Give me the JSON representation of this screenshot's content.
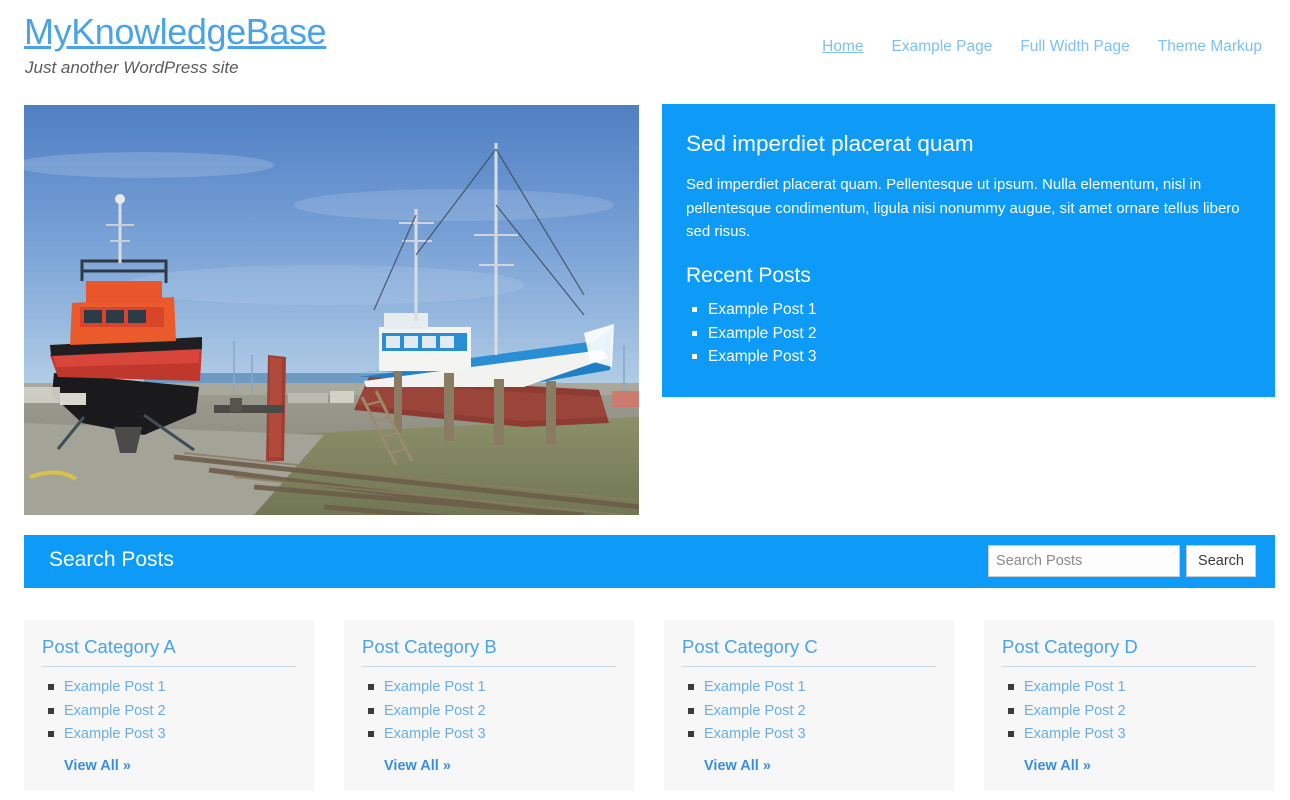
{
  "site": {
    "title": "MyKnowledgeBase",
    "tagline": "Just another WordPress site",
    "accent_color": "#0d9bf7",
    "link_color": "#4aa3e8",
    "card_background": "#f7f7f7"
  },
  "nav": {
    "items": [
      {
        "label": "Home",
        "active": true
      },
      {
        "label": "Example Page",
        "active": false
      },
      {
        "label": "Full Width Page",
        "active": false
      },
      {
        "label": "Theme Markup",
        "active": false
      }
    ]
  },
  "hero": {
    "image_alt": "Shipyard dry dock with a red tugboat and a blue and red fishing trawler on slipway rails under a blue sky"
  },
  "promo": {
    "title": "Sed imperdiet placerat quam",
    "text": "Sed imperdiet placerat quam. Pellentesque ut ipsum. Nulla elementum, nisl in pellentesque condimentum, ligula nisi nonummy augue, sit amet ornare tellus libero sed risus.",
    "subtitle": "Recent Posts",
    "posts": [
      "Example Post 1",
      "Example Post 2",
      "Example Post 3"
    ]
  },
  "search": {
    "heading": "Search Posts",
    "placeholder": "Search Posts",
    "value": "",
    "button": "Search"
  },
  "categories": [
    {
      "title": "Post Category A",
      "posts": [
        "Example Post 1",
        "Example Post 2",
        "Example Post 3"
      ],
      "view_all": "View All »"
    },
    {
      "title": "Post Category B",
      "posts": [
        "Example Post 1",
        "Example Post 2",
        "Example Post 3"
      ],
      "view_all": "View All »"
    },
    {
      "title": "Post Category C",
      "posts": [
        "Example Post 1",
        "Example Post 2",
        "Example Post 3"
      ],
      "view_all": "View All »"
    },
    {
      "title": "Post Category D",
      "posts": [
        "Example Post 1",
        "Example Post 2",
        "Example Post 3"
      ],
      "view_all": "View All »"
    }
  ]
}
